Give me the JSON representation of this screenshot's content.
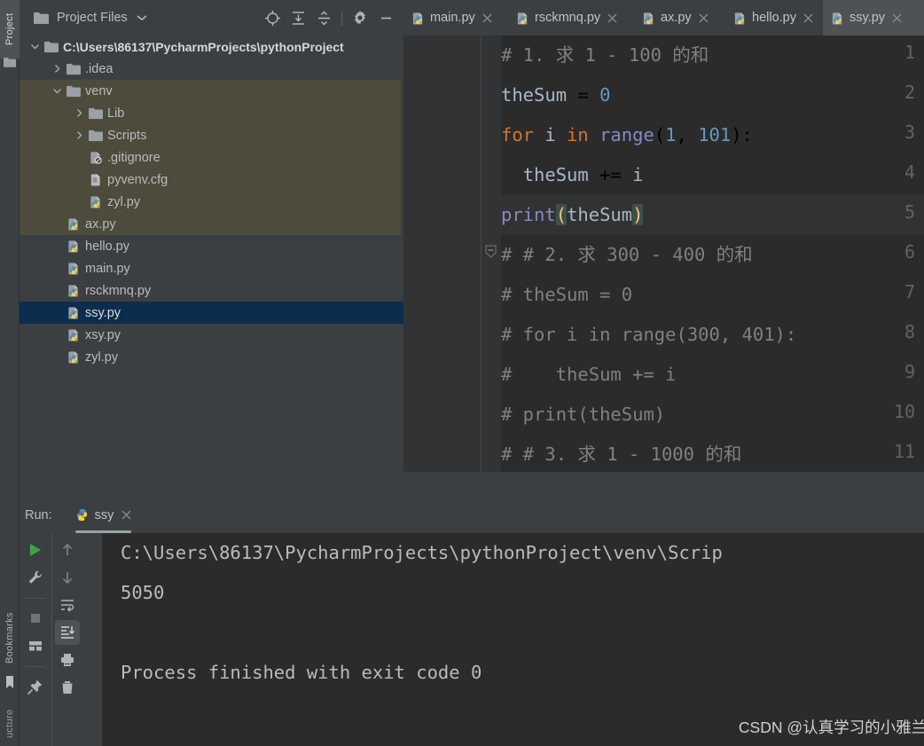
{
  "left_toolbar": {
    "project_label": "Project",
    "bookmarks_label": "Bookmarks",
    "structure_label": "ucture"
  },
  "project_panel": {
    "title": "Project Files",
    "tools": [
      "locate-icon",
      "expand-all-icon",
      "collapse-all-icon",
      "settings-gear-icon",
      "minimize-icon"
    ],
    "tree": [
      {
        "label": "C:\\Users\\86137\\PycharmProjects\\pythonProject",
        "type": "root",
        "indent": 0,
        "state": "expanded",
        "selected": false
      },
      {
        "label": ".idea",
        "type": "folder",
        "indent": 1,
        "state": "collapsed",
        "selected": false
      },
      {
        "label": "venv",
        "type": "folder",
        "indent": 1,
        "state": "expanded",
        "selected": false
      },
      {
        "label": "Lib",
        "type": "folder",
        "indent": 2,
        "state": "collapsed",
        "selected": false
      },
      {
        "label": "Scripts",
        "type": "folder",
        "indent": 2,
        "state": "collapsed",
        "selected": false
      },
      {
        "label": ".gitignore",
        "type": "gitignore",
        "indent": 2,
        "state": "none",
        "selected": false
      },
      {
        "label": "pyvenv.cfg",
        "type": "config",
        "indent": 2,
        "state": "none",
        "selected": false
      },
      {
        "label": "zyl.py",
        "type": "python",
        "indent": 2,
        "state": "none",
        "selected": false
      },
      {
        "label": "ax.py",
        "type": "python",
        "indent": 1,
        "state": "none",
        "selected": false
      },
      {
        "label": "hello.py",
        "type": "python",
        "indent": 1,
        "state": "none",
        "selected": false
      },
      {
        "label": "main.py",
        "type": "python",
        "indent": 1,
        "state": "none",
        "selected": false
      },
      {
        "label": "rsckmnq.py",
        "type": "python",
        "indent": 1,
        "state": "none",
        "selected": false
      },
      {
        "label": "ssy.py",
        "type": "python",
        "indent": 1,
        "state": "none",
        "selected": true
      },
      {
        "label": "xsy.py",
        "type": "python",
        "indent": 1,
        "state": "none",
        "selected": false
      },
      {
        "label": "zyl.py",
        "type": "python",
        "indent": 1,
        "state": "none",
        "selected": false
      }
    ]
  },
  "editor": {
    "tabs": [
      {
        "label": "main.py",
        "active": false
      },
      {
        "label": "rsckmnq.py",
        "active": false
      },
      {
        "label": "ax.py",
        "active": false
      },
      {
        "label": "hello.py",
        "active": false
      },
      {
        "label": "ssy.py",
        "active": true
      }
    ],
    "line_numbers": [
      "1",
      "2",
      "3",
      "4",
      "5",
      "6",
      "7",
      "8",
      "9",
      "10",
      "11"
    ],
    "caret_line": 5,
    "fold_marker_line": 6,
    "warning_underline_line": 4,
    "lines": [
      "# 1. 求 1 - 100 的和",
      "theSum = 0",
      "for i in range(1, 101):",
      "  theSum += i",
      "print(theSum)",
      "# # 2. 求 300 - 400 的和",
      "# theSum = 0",
      "# for i in range(300, 401):",
      "#    theSum += i",
      "# print(theSum)",
      "# # 3. 求 1 - 1000 的和"
    ],
    "colors": {
      "background": "#2b2b2b",
      "gutter": "#313335",
      "comment": "#808080",
      "keyword": "#cc7832",
      "number": "#6897bb",
      "identifier": "#a9b7c6",
      "function_call": "#8888c6",
      "bracket_match": "#ffc66d",
      "caret_line": "#323232",
      "warning_squiggle": "#bbb529"
    }
  },
  "run_panel": {
    "label": "Run:",
    "tab_label": "ssy",
    "toolbar_left": [
      "run-icon",
      "wrench-icon",
      "stop-icon",
      "layout-icon",
      "pin-icon"
    ],
    "toolbar_right": [
      "arrow-up-icon",
      "arrow-down-icon",
      "soft-wrap-icon",
      "scroll-to-end-icon",
      "print-icon",
      "trash-icon"
    ],
    "active_toolbar_icon": "scroll-to-end-icon",
    "console_lines": [
      "C:\\Users\\86137\\PycharmProjects\\pythonProject\\venv\\Scrip",
      "5050",
      "",
      "Process finished with exit code 0"
    ]
  },
  "watermark": {
    "text": "CSDN @认真学习的小雅兰."
  }
}
